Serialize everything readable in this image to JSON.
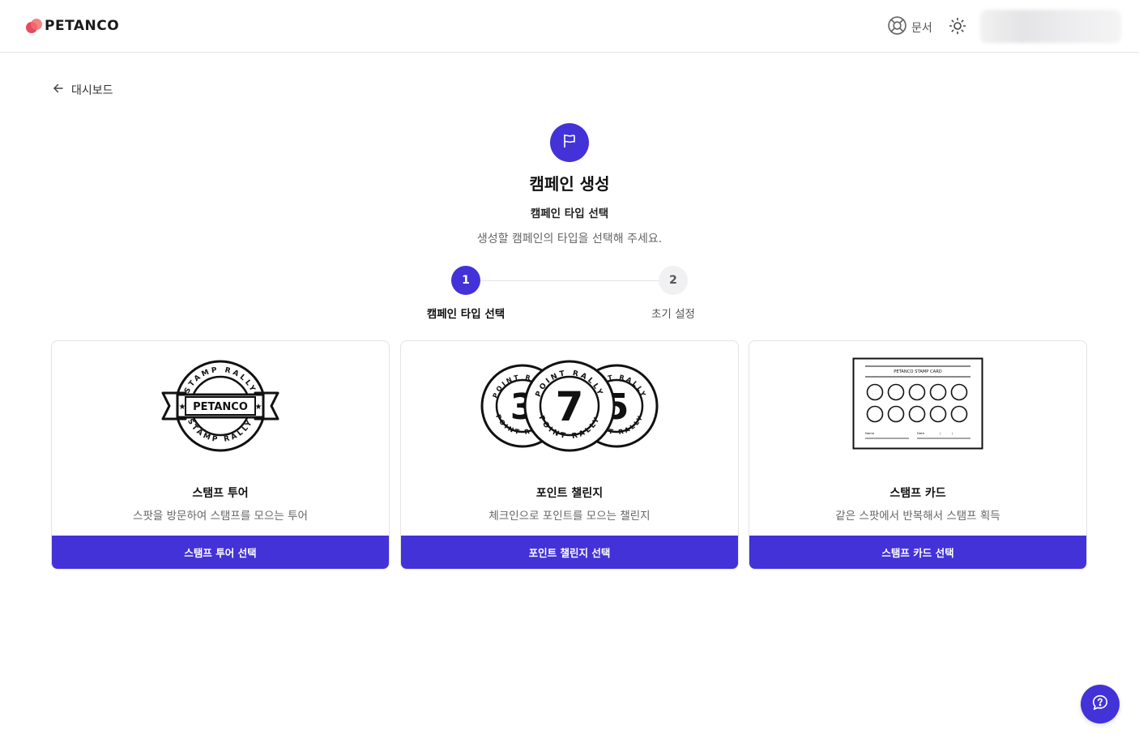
{
  "brand": {
    "name": "PETANCO",
    "accent": "#4332d8",
    "logo_colors": [
      "#f26d6d",
      "#e84a5f"
    ]
  },
  "header": {
    "docs_label": "문서",
    "docs_icon": "lifebuoy-icon",
    "theme_icon": "sun-icon"
  },
  "nav": {
    "back_label": "대시보드",
    "back_icon": "arrow-left-icon"
  },
  "page": {
    "icon": "flag-icon",
    "title": "캠페인 생성",
    "subtitle": "캠페인 타입 선택",
    "description": "생성할 캠페인의 타입을 선택해 주세요."
  },
  "stepper": {
    "steps": [
      {
        "number": "1",
        "label": "캠페인 타입 선택",
        "state": "active"
      },
      {
        "number": "2",
        "label": "초기 설정",
        "state": "inactive"
      }
    ]
  },
  "cards": [
    {
      "illustration": "stamp-rally-badge",
      "illustration_text": {
        "badge": "PETANCO",
        "ring": "STAMP RALLY"
      },
      "title": "스탬프 투어",
      "description": "스팟을 방문하여 스탬프를 모으는 투어",
      "button_label": "스탬프 투어 선택"
    },
    {
      "illustration": "point-rally-coins",
      "illustration_text": {
        "ring": "POINT RALLY",
        "numbers": [
          "3",
          "7",
          "5"
        ]
      },
      "title": "포인트 챌린지",
      "description": "체크인으로 포인트를 모으는 챌린지",
      "button_label": "포인트 챌린지 선택"
    },
    {
      "illustration": "stamp-card",
      "illustration_text": {
        "header": "PETANCO STAMP CARD",
        "name_label": "Name",
        "date_label": "Date"
      },
      "title": "스탬프 카드",
      "description": "같은 스팟에서 반복해서 스탬프 획득",
      "button_label": "스탬프 카드 선택"
    }
  ],
  "help": {
    "icon": "help-question-icon"
  }
}
